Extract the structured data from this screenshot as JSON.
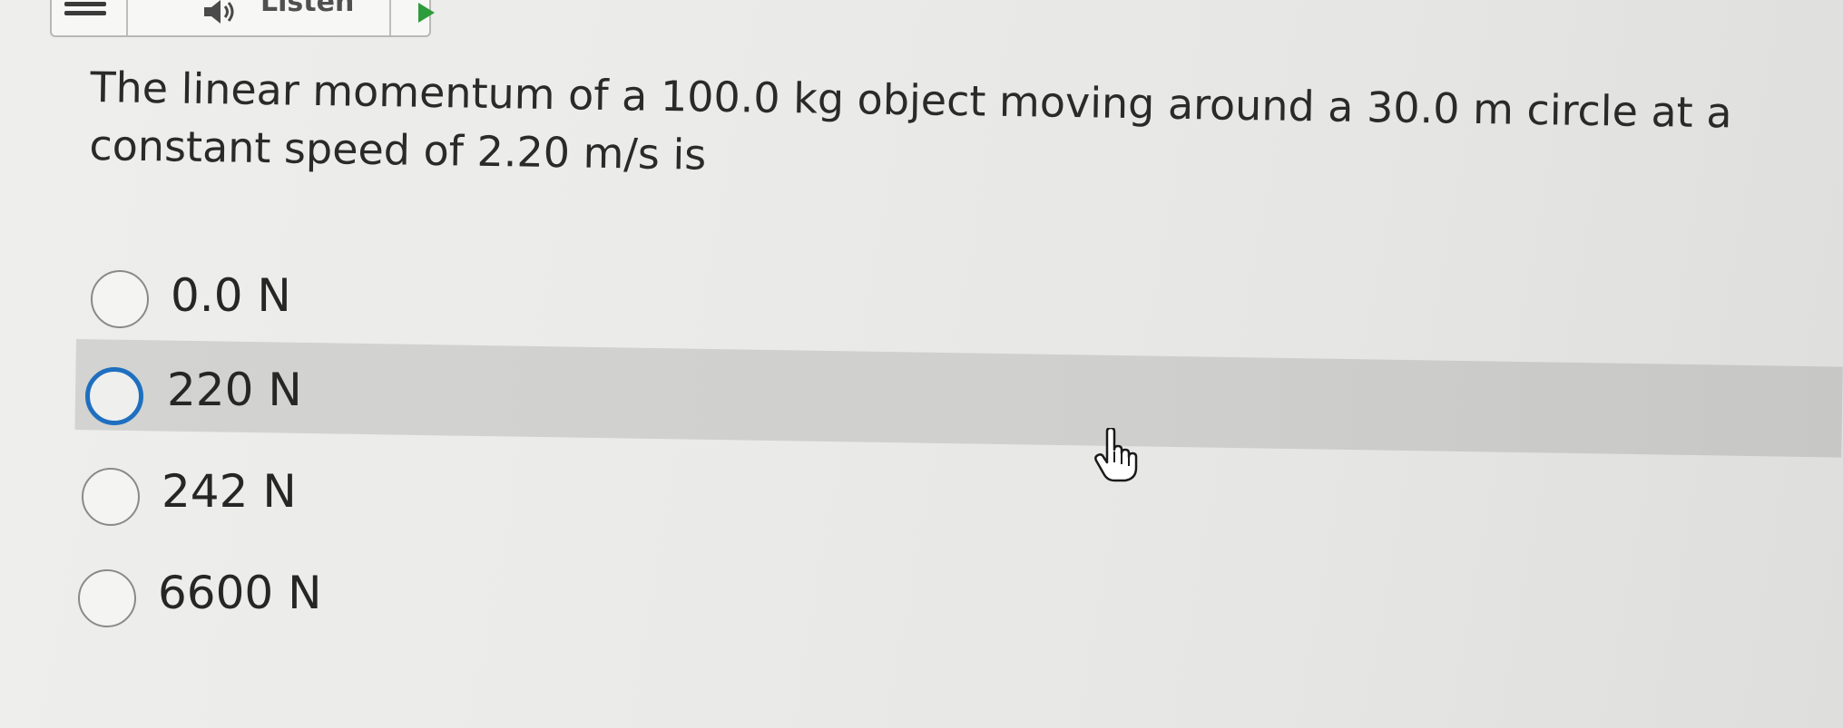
{
  "toolbar": {
    "menu_icon": "hamburger-menu-icon",
    "listen_label": "Listen",
    "speaker_icon": "speaker-icon",
    "play_icon": "play-icon",
    "accent_color": "#2d9c3a"
  },
  "question": {
    "text": "The linear momentum of a 100.0 kg object moving around a 30.0 m circle at a constant speed of 2.20 m/s is"
  },
  "options": [
    {
      "label": "0.0 N",
      "selected": false,
      "highlighted": false
    },
    {
      "label": "220 N",
      "selected": false,
      "highlighted": true
    },
    {
      "label": "242 N",
      "selected": false,
      "highlighted": false
    },
    {
      "label": "6600 N",
      "selected": false,
      "highlighted": false
    }
  ],
  "colors": {
    "focus_ring": "#1f6fc0",
    "highlight_row": "#d0d0ce"
  },
  "cursor": "pointer-hand-icon"
}
